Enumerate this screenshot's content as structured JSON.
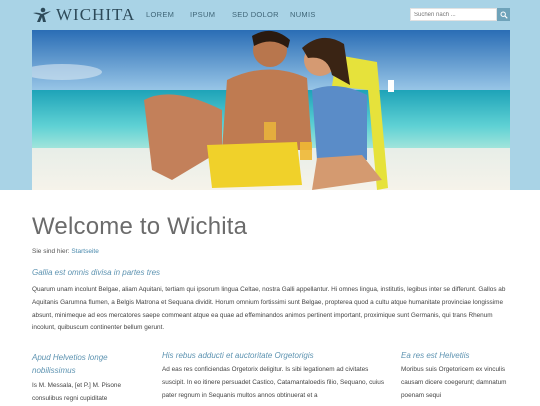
{
  "header": {
    "logo_text": "WICHITA",
    "nav": [
      "LOREM",
      "IPSUM",
      "SED DOLOR",
      "NUMIS"
    ],
    "search_placeholder": "Suchen nach ..."
  },
  "main": {
    "title": "Welcome to Wichita",
    "breadcrumb_prefix": "Sie sind hier:",
    "breadcrumb_link": "Startseite",
    "intro_heading": "Gallia est omnis divisa in partes tres",
    "intro_text": "Quarum unam incolunt Belgae, aliam Aquitani, tertiam qui ipsorum lingua Celtae, nostra Galli appellantur. Hi omnes lingua, institutis, legibus inter se differunt. Gallos ab Aquitanis Garumna flumen, a Belgis Matrona et Sequana dividit. Horum omnium fortissimi sunt Belgae, propterea quod a cultu atque humanitate provinciae longissime absunt, minimeque ad eos mercatores saepe commeant atque ea quae ad effeminandos animos pertinent important, proximique sunt Germanis, qui trans Rhenum incolunt, quibuscum continenter bellum gerunt.",
    "columns": [
      {
        "heading": "Apud Helvetios longe nobilissimus",
        "text": "Is M. Messala, [et P.] M. Pisone consulibus regni cupiditate"
      },
      {
        "heading": "His rebus adducti et auctoritate Orgetorigis",
        "text": "Ad eas res conficiendas Orgetorix deligitur. Is sibi legationem ad civitates suscipit. In eo itinere persuadet Castico, Catamantaloedis filio, Sequano, cuius pater regnum in Sequanis multos annos obtinuerat et a"
      },
      {
        "heading": "Ea res est Helvetiis",
        "text": "Moribus suis Orgetoricem ex vinculis causam dicere coegerunt; damnatum poenam sequi"
      }
    ]
  },
  "colors": {
    "header_band": "#a9d3e6",
    "accent": "#5d93b1",
    "link": "#4a8aad"
  }
}
